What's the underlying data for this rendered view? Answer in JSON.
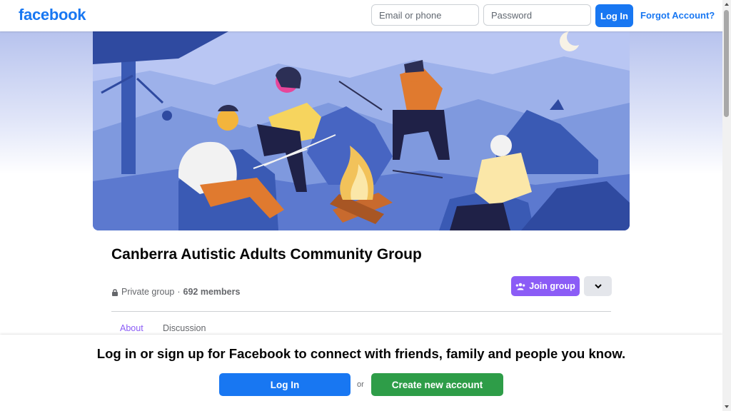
{
  "header": {
    "logo": "facebook",
    "email_placeholder": "Email or phone",
    "password_placeholder": "Password",
    "login_label": "Log In",
    "forgot_label": "Forgot Account?"
  },
  "group": {
    "name": "Canberra Autistic Adults Community Group",
    "privacy": "Private group",
    "separator": "·",
    "members": "692 members",
    "join_label": "Join group"
  },
  "tabs": [
    {
      "label": "About",
      "active": true
    },
    {
      "label": "Discussion",
      "active": false
    }
  ],
  "signup_prompt": {
    "text": "Log in or sign up for Facebook to connect with friends, family and people you know.",
    "login_label": "Log In",
    "or_label": "or",
    "create_label": "Create new account"
  },
  "colors": {
    "brand": "#1877f2",
    "join": "#8b5cf6",
    "create": "#2e9d48"
  },
  "icons": {
    "privacy": "lock-icon",
    "join": "people-icon",
    "more": "chevron-down-icon"
  }
}
